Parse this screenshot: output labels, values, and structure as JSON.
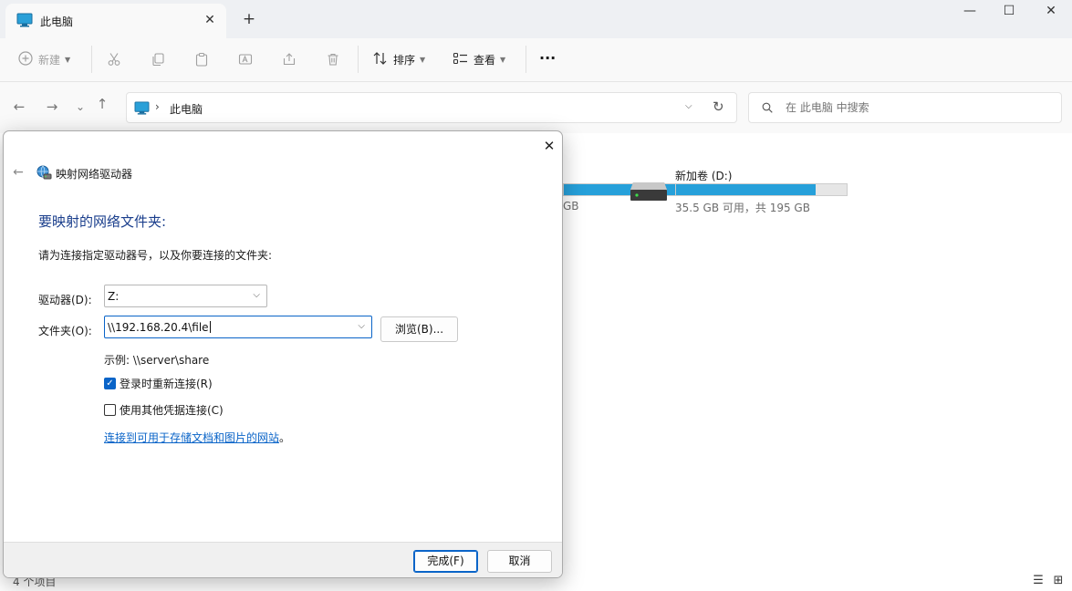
{
  "window": {
    "tab_title": "此电脑",
    "tab_close": "✕",
    "new_tab": "+",
    "minimize": "—",
    "maximize": "☐",
    "close": "✕"
  },
  "toolbar": {
    "new_label": "新建",
    "sort_label": "排序",
    "view_label": "查看",
    "more": "···"
  },
  "navbar": {
    "back": "←",
    "forward": "→",
    "recent": "⌄",
    "up": "↑",
    "address_separator": "›",
    "address": "此电脑",
    "address_dropdown": "⌵",
    "refresh": "↻",
    "search_placeholder": "在 此电脑 中搜索"
  },
  "drives": [
    {
      "name": "",
      "info": "GB",
      "used_fraction": 0.82
    },
    {
      "name": "新加卷 (D:)",
      "info": "35.5 GB 可用，共 195 GB",
      "used_fraction": 0.82
    }
  ],
  "statusbar": {
    "item_count": "4 个项目",
    "details_view": "☰",
    "tiles_view": "⊞"
  },
  "dialog": {
    "close": "✕",
    "back": "←",
    "title": "映射网络驱动器",
    "heading": "要映射的网络文件夹:",
    "description": "请为连接指定驱动器号，以及你要连接的文件夹:",
    "drive_label": "驱动器(D):",
    "drive_value": "Z:",
    "folder_label": "文件夹(O):",
    "folder_value": "\\\\192.168.20.4\\file",
    "browse_button": "浏览(B)...",
    "example": "示例: \\\\server\\share",
    "reconnect_label": "登录时重新连接(R)",
    "reconnect_checked": true,
    "other_credentials_label": "使用其他凭据连接(C)",
    "other_credentials_checked": false,
    "link_text": "连接到可用于存储文档和图片的网站",
    "link_period": "。",
    "finish_button": "完成(F)",
    "cancel_button": "取消"
  },
  "colors": {
    "accent": "#0a64c8",
    "heading": "#1a3e8c",
    "drive_fill": "#26a0da"
  }
}
